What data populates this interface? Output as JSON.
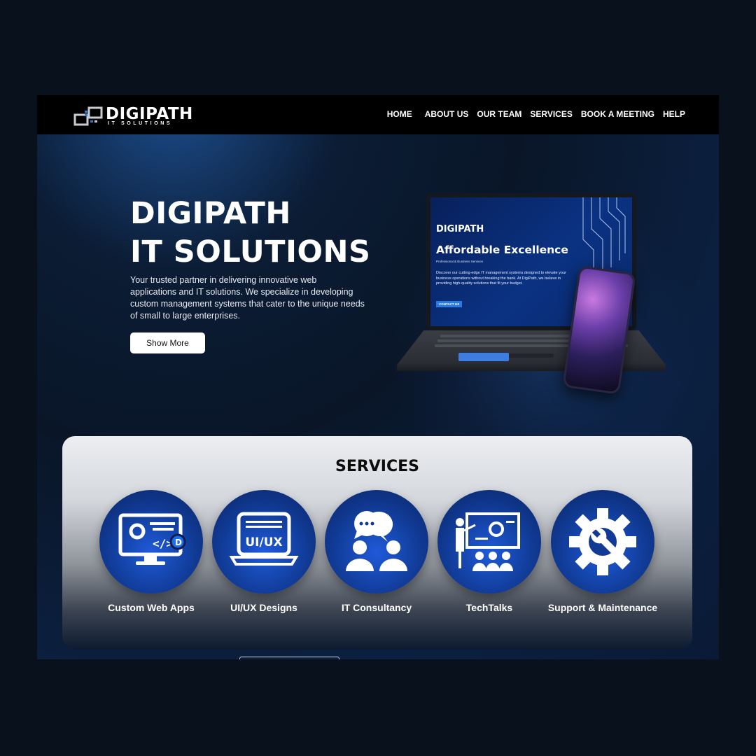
{
  "brand": {
    "name": "DIGIPATH",
    "subtitle": "IT SOLUTIONS"
  },
  "nav": {
    "items": [
      "HOME",
      "ABOUT US",
      "OUR TEAM",
      "SERVICES",
      "BOOK A MEETING",
      "HELP"
    ]
  },
  "hero": {
    "title_line1": "DIGIPATH",
    "title_line2": "IT SOLUTIONS",
    "description": "Your trusted partner in delivering innovative web applications and IT solutions. We specialize in developing custom management systems that cater to the unique needs of small to large enterprises.",
    "cta_label": "Show More"
  },
  "laptop_display": {
    "logo": "DIGIPATH",
    "headline": "Affordable Excellence",
    "subline": "Professional & Business Services",
    "body": "Discover our cutting-edge IT management systems designed to elevate your business operations without breaking the bank. At DigiPath, we believe in providing high-quality solutions that fit your budget.",
    "button": "CONTACT US"
  },
  "services": {
    "title": "SERVICES",
    "items": [
      {
        "label": "Custom Web Apps",
        "icon": "web-app-icon"
      },
      {
        "label": "UI/UX Designs",
        "icon": "uiux-laptop-icon",
        "icon_text": "UI/UX"
      },
      {
        "label": "IT Consultancy",
        "icon": "consultancy-chat-icon"
      },
      {
        "label": "TechTalks",
        "icon": "presentation-icon"
      },
      {
        "label": "Support & Maintenance",
        "icon": "gear-wrench-icon"
      }
    ]
  },
  "colors": {
    "page_bg": "#08111c",
    "navbar": "#000000",
    "hero_blue": "#0b2040",
    "service_circle": "#1f5ad8"
  }
}
